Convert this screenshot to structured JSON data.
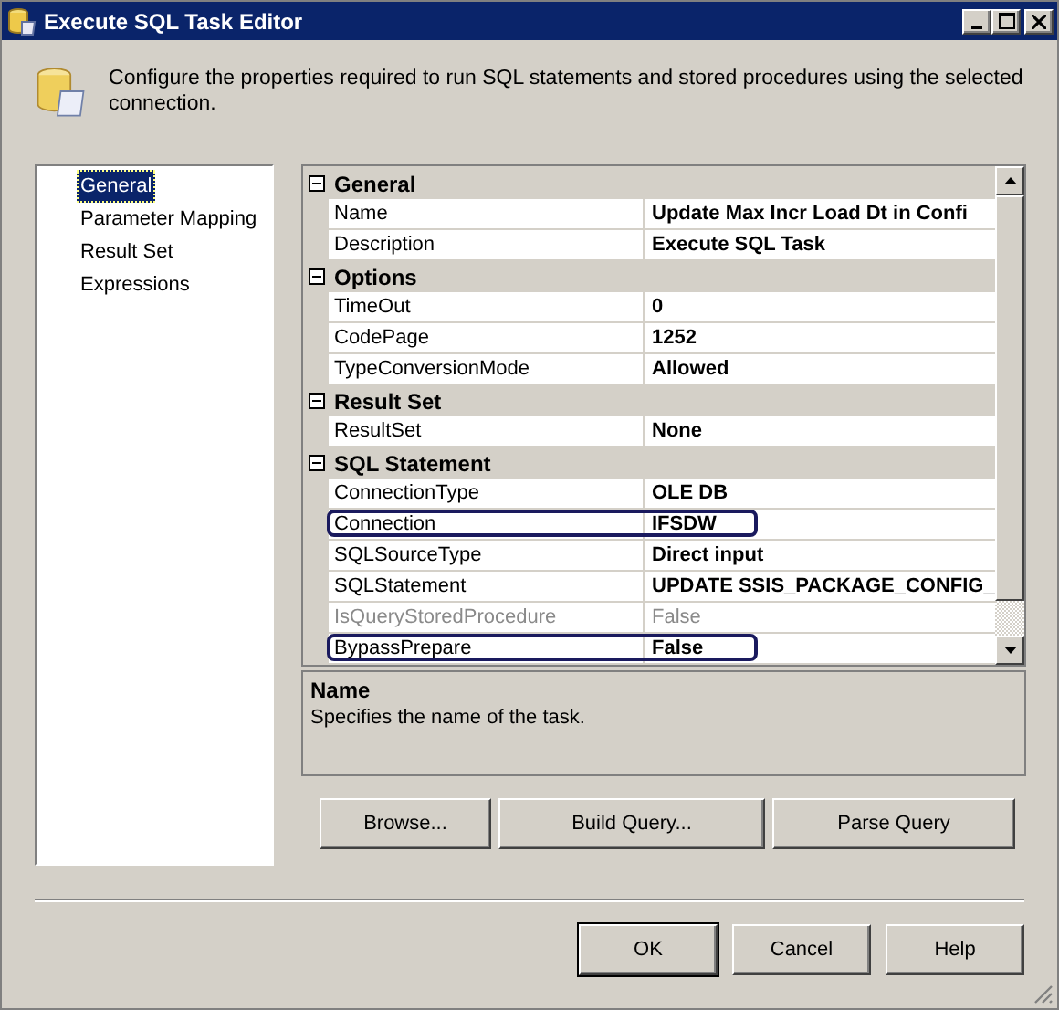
{
  "window": {
    "title": "Execute SQL Task Editor"
  },
  "header": {
    "text": "Configure the properties required to run SQL statements and stored procedures using the selected connection."
  },
  "nav": [
    {
      "label": "General",
      "selected": true
    },
    {
      "label": "Parameter Mapping",
      "selected": false
    },
    {
      "label": "Result Set",
      "selected": false
    },
    {
      "label": "Expressions",
      "selected": false
    }
  ],
  "grid": [
    {
      "category": "General",
      "expanded": true,
      "properties": [
        {
          "name": "Name",
          "value": "Update Max Incr Load Dt in Confi",
          "disabled": false,
          "highlighted": false
        },
        {
          "name": "Description",
          "value": "Execute SQL Task",
          "disabled": false,
          "highlighted": false
        }
      ]
    },
    {
      "category": "Options",
      "expanded": true,
      "properties": [
        {
          "name": "TimeOut",
          "value": "0",
          "disabled": false,
          "highlighted": false
        },
        {
          "name": "CodePage",
          "value": "1252",
          "disabled": false,
          "highlighted": false
        },
        {
          "name": "TypeConversionMode",
          "value": "Allowed",
          "disabled": false,
          "highlighted": false
        }
      ]
    },
    {
      "category": "Result Set",
      "expanded": true,
      "properties": [
        {
          "name": "ResultSet",
          "value": "None",
          "disabled": false,
          "highlighted": false
        }
      ]
    },
    {
      "category": "SQL Statement",
      "expanded": true,
      "properties": [
        {
          "name": "ConnectionType",
          "value": "OLE DB",
          "disabled": false,
          "highlighted": false
        },
        {
          "name": "Connection",
          "value": "IFSDW",
          "disabled": false,
          "highlighted": true
        },
        {
          "name": "SQLSourceType",
          "value": "Direct input",
          "disabled": false,
          "highlighted": false
        },
        {
          "name": "SQLStatement",
          "value": "UPDATE SSIS_PACKAGE_CONFIG_",
          "disabled": false,
          "highlighted": false
        },
        {
          "name": "IsQueryStoredProcedure",
          "value": "False",
          "disabled": true,
          "highlighted": false
        },
        {
          "name": "BypassPrepare",
          "value": "False",
          "disabled": false,
          "highlighted": true
        }
      ]
    }
  ],
  "description": {
    "title": "Name",
    "text": "Specifies the name of the task."
  },
  "grid_buttons": [
    "Browse...",
    "Build Query...",
    "Parse Query"
  ],
  "dialog_buttons": [
    {
      "label": "OK",
      "default": true
    },
    {
      "label": "Cancel",
      "default": false
    },
    {
      "label": "Help",
      "default": false
    }
  ]
}
